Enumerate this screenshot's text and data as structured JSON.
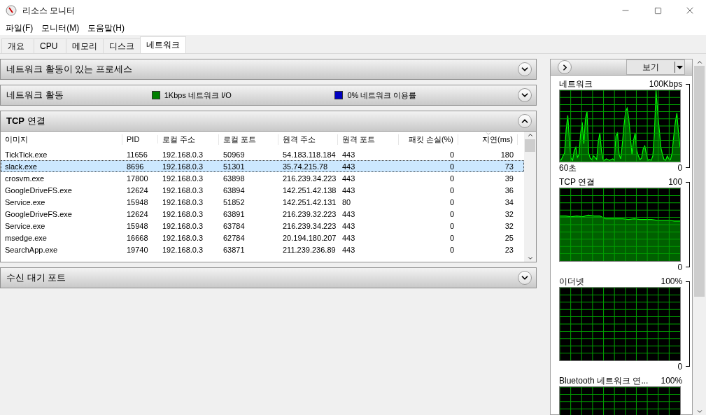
{
  "window": {
    "title": "리소스 모니터"
  },
  "menu": [
    "파일(F)",
    "모니터(M)",
    "도움말(H)"
  ],
  "tabs": [
    {
      "label": "개요",
      "selected": false
    },
    {
      "label": "CPU",
      "selected": false
    },
    {
      "label": "메모리",
      "selected": false
    },
    {
      "label": "디스크",
      "selected": false
    },
    {
      "label": "네트워크",
      "selected": true
    }
  ],
  "sections": [
    {
      "title": "네트워크 활동이 있는 프로세스",
      "expanded": false
    },
    {
      "title": "네트워크 활동",
      "expanded": false,
      "legend": [
        {
          "text": "1Kbps 네트워크 I/O",
          "color": "#008000"
        },
        {
          "text": "0% 네트워크 이용률",
          "color": "#0000c0"
        }
      ]
    },
    {
      "title": "**TCP** 연결",
      "expanded": true,
      "table": {
        "columns": [
          {
            "label": "이미지",
            "kind": "text",
            "sorted": false
          },
          {
            "label": "PID",
            "kind": "text",
            "sorted": false
          },
          {
            "label": "로컬 주소",
            "kind": "text",
            "sorted": false
          },
          {
            "label": "로컬 포트",
            "kind": "text",
            "sorted": false
          },
          {
            "label": "원격 주소",
            "kind": "text",
            "sorted": false
          },
          {
            "label": "원격 포트",
            "kind": "text",
            "sorted": false
          },
          {
            "label": "패킷 손실(%)",
            "kind": "numeric",
            "sorted": false
          },
          {
            "label": "지연(ms)",
            "kind": "numeric",
            "sorted": true
          }
        ],
        "rows": [
          {
            "selected": false,
            "cells": [
              "TickTick.exe",
              "11656",
              "192.168.0.3",
              "50969",
              "54.183.118.184",
              "443",
              "0",
              "180"
            ]
          },
          {
            "selected": true,
            "cells": [
              "slack.exe",
              "8696",
              "192.168.0.3",
              "51301",
              "35.74.215.78",
              "443",
              "0",
              "73"
            ]
          },
          {
            "selected": false,
            "cells": [
              "crosvm.exe",
              "17800",
              "192.168.0.3",
              "63898",
              "216.239.34.223",
              "443",
              "0",
              "39"
            ]
          },
          {
            "selected": false,
            "cells": [
              "GoogleDriveFS.exe",
              "12624",
              "192.168.0.3",
              "63894",
              "142.251.42.138",
              "443",
              "0",
              "36"
            ]
          },
          {
            "selected": false,
            "cells": [
              "Service.exe",
              "15948",
              "192.168.0.3",
              "51852",
              "142.251.42.131",
              "80",
              "0",
              "34"
            ]
          },
          {
            "selected": false,
            "cells": [
              "GoogleDriveFS.exe",
              "12624",
              "192.168.0.3",
              "63891",
              "216.239.32.223",
              "443",
              "0",
              "32"
            ]
          },
          {
            "selected": false,
            "cells": [
              "Service.exe",
              "15948",
              "192.168.0.3",
              "63784",
              "216.239.34.223",
              "443",
              "0",
              "32"
            ]
          },
          {
            "selected": false,
            "cells": [
              "msedge.exe",
              "16668",
              "192.168.0.3",
              "62784",
              "20.194.180.207",
              "443",
              "0",
              "25"
            ]
          },
          {
            "selected": false,
            "cells": [
              "SearchApp.exe",
              "19740",
              "192.168.0.3",
              "63871",
              "211.239.236.89",
              "443",
              "0",
              "23"
            ]
          }
        ]
      }
    },
    {
      "title": "수신 대기 포트",
      "expanded": false
    }
  ],
  "side_panel": {
    "view_button": "보기",
    "graphs": [
      {
        "kind": "spikes",
        "title": "네트워크",
        "max": "100Kbps",
        "time": "60초",
        "min": "0"
      },
      {
        "kind": "area",
        "title": "TCP 연결",
        "max": "100",
        "min": "0"
      },
      {
        "kind": "empty",
        "title": "이더넷",
        "max": "100%",
        "min": "0"
      },
      {
        "kind": "empty",
        "title": "Bluetooth 네트워크 연...",
        "max": "100%"
      }
    ]
  }
}
